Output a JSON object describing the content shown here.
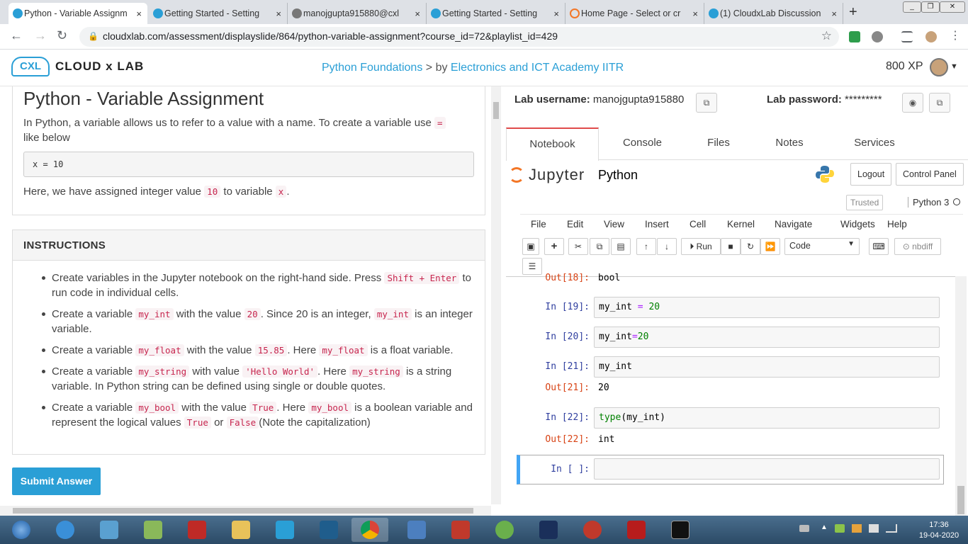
{
  "browser": {
    "tabs": [
      {
        "title": "Python - Variable Assignm",
        "active": true
      },
      {
        "title": "Getting Started - Setting",
        "active": false
      },
      {
        "title": "manojgupta915880@cxl",
        "active": false
      },
      {
        "title": "Getting Started - Setting",
        "active": false
      },
      {
        "title": "Home Page - Select or cr",
        "active": false
      },
      {
        "title": "(1) CloudxLab Discussion",
        "active": false
      }
    ],
    "close_glyph": "×",
    "new_tab": "+",
    "url": "cloudxlab.com/assessment/displayslide/864/python-variable-assignment?course_id=72&playlist_id=429"
  },
  "site": {
    "logo_mark": "CXL",
    "brand": "CLOUD x LAB",
    "course_link": "Python Foundations",
    "course_sep": " > by ",
    "academy_link": "Electronics and ICT Academy IITR",
    "xp": "800 XP"
  },
  "lesson": {
    "title": "Python - Variable Assignment",
    "intro_a": "In Python, a variable allows us to refer to a value with a name. To create a variable use",
    "intro_code": "=",
    "intro_b": "like below",
    "code_example": "x = 10",
    "para_a": "Here, we have assigned integer value",
    "para_code1": "10",
    "para_b": "to variable",
    "para_code2": "x",
    "para_c": ".",
    "instructions_heading": "INSTRUCTIONS",
    "b1_a": "Create variables in the Jupyter notebook on the right-hand side. Press",
    "b1_code": "Shift + Enter",
    "b1_b": "to run code in individual cells.",
    "b2_a": "Create a variable",
    "b2_code1": "my_int",
    "b2_b": "with the value",
    "b2_code2": "20",
    "b2_c": ". Since 20 is an integer,",
    "b2_code3": "my_int",
    "b2_d": "is an integer variable.",
    "b3_a": "Create a variable",
    "b3_code1": "my_float",
    "b3_b": "with the value",
    "b3_code2": "15.85",
    "b3_c": ". Here",
    "b3_code3": "my_float",
    "b3_d": "is a float variable.",
    "b4_a": "Create a variable",
    "b4_code1": "my_string",
    "b4_b": "with value",
    "b4_code2": "'Hello World'",
    "b4_c": ". Here",
    "b4_code3": "my_string",
    "b4_d": "is a string variable. In Python string can be defined using single or double quotes.",
    "b5_a": "Create a variable",
    "b5_code1": "my_bool",
    "b5_b": "with the value",
    "b5_code2": "True",
    "b5_c": ". Here",
    "b5_code3": "my_bool",
    "b5_d": "is a boolean variable and represent the logical values",
    "b5_code4": "True",
    "b5_e": "or",
    "b5_code5": "False",
    "b5_f": "(Note the capitalization)",
    "submit": "Submit Answer"
  },
  "lab": {
    "username_label": "Lab username:",
    "username": "manojgupta915880",
    "password_label": "Lab password:",
    "password": "*********",
    "tabs": [
      "Notebook",
      "Console",
      "Files",
      "Notes",
      "Services"
    ],
    "jupyter_word": "Jupyter",
    "notebook_name": "Python",
    "logout": "Logout",
    "control_panel": "Control Panel",
    "trusted": "Trusted",
    "kernel": "Python 3",
    "menu": [
      "File",
      "Edit",
      "View",
      "Insert",
      "Cell",
      "Kernel",
      "Navigate",
      "Widgets",
      "Help"
    ],
    "run": "Run",
    "cell_type": "Code",
    "nbdiff": "nbdiff",
    "cells": [
      {
        "out_prompt": "Out[18]:",
        "output": "bool"
      },
      {
        "in_prompt": "In [19]:",
        "code_var": "my_int",
        "code_op": "=",
        "code_num": "20"
      },
      {
        "in_prompt": "In [20]:",
        "code_var": "my_int",
        "code_op": "=",
        "code_num": "20"
      },
      {
        "in_prompt": "In [21]:",
        "code": "my_int",
        "out_prompt": "Out[21]:",
        "output": "20"
      },
      {
        "in_prompt": "In [22]:",
        "code_fn": "type",
        "code_arg": "(my_int)",
        "out_prompt": "Out[22]:",
        "output": "int"
      },
      {
        "in_prompt": "In [ ]:"
      }
    ]
  },
  "taskbar": {
    "time": "17:36",
    "date": "19-04-2020"
  }
}
